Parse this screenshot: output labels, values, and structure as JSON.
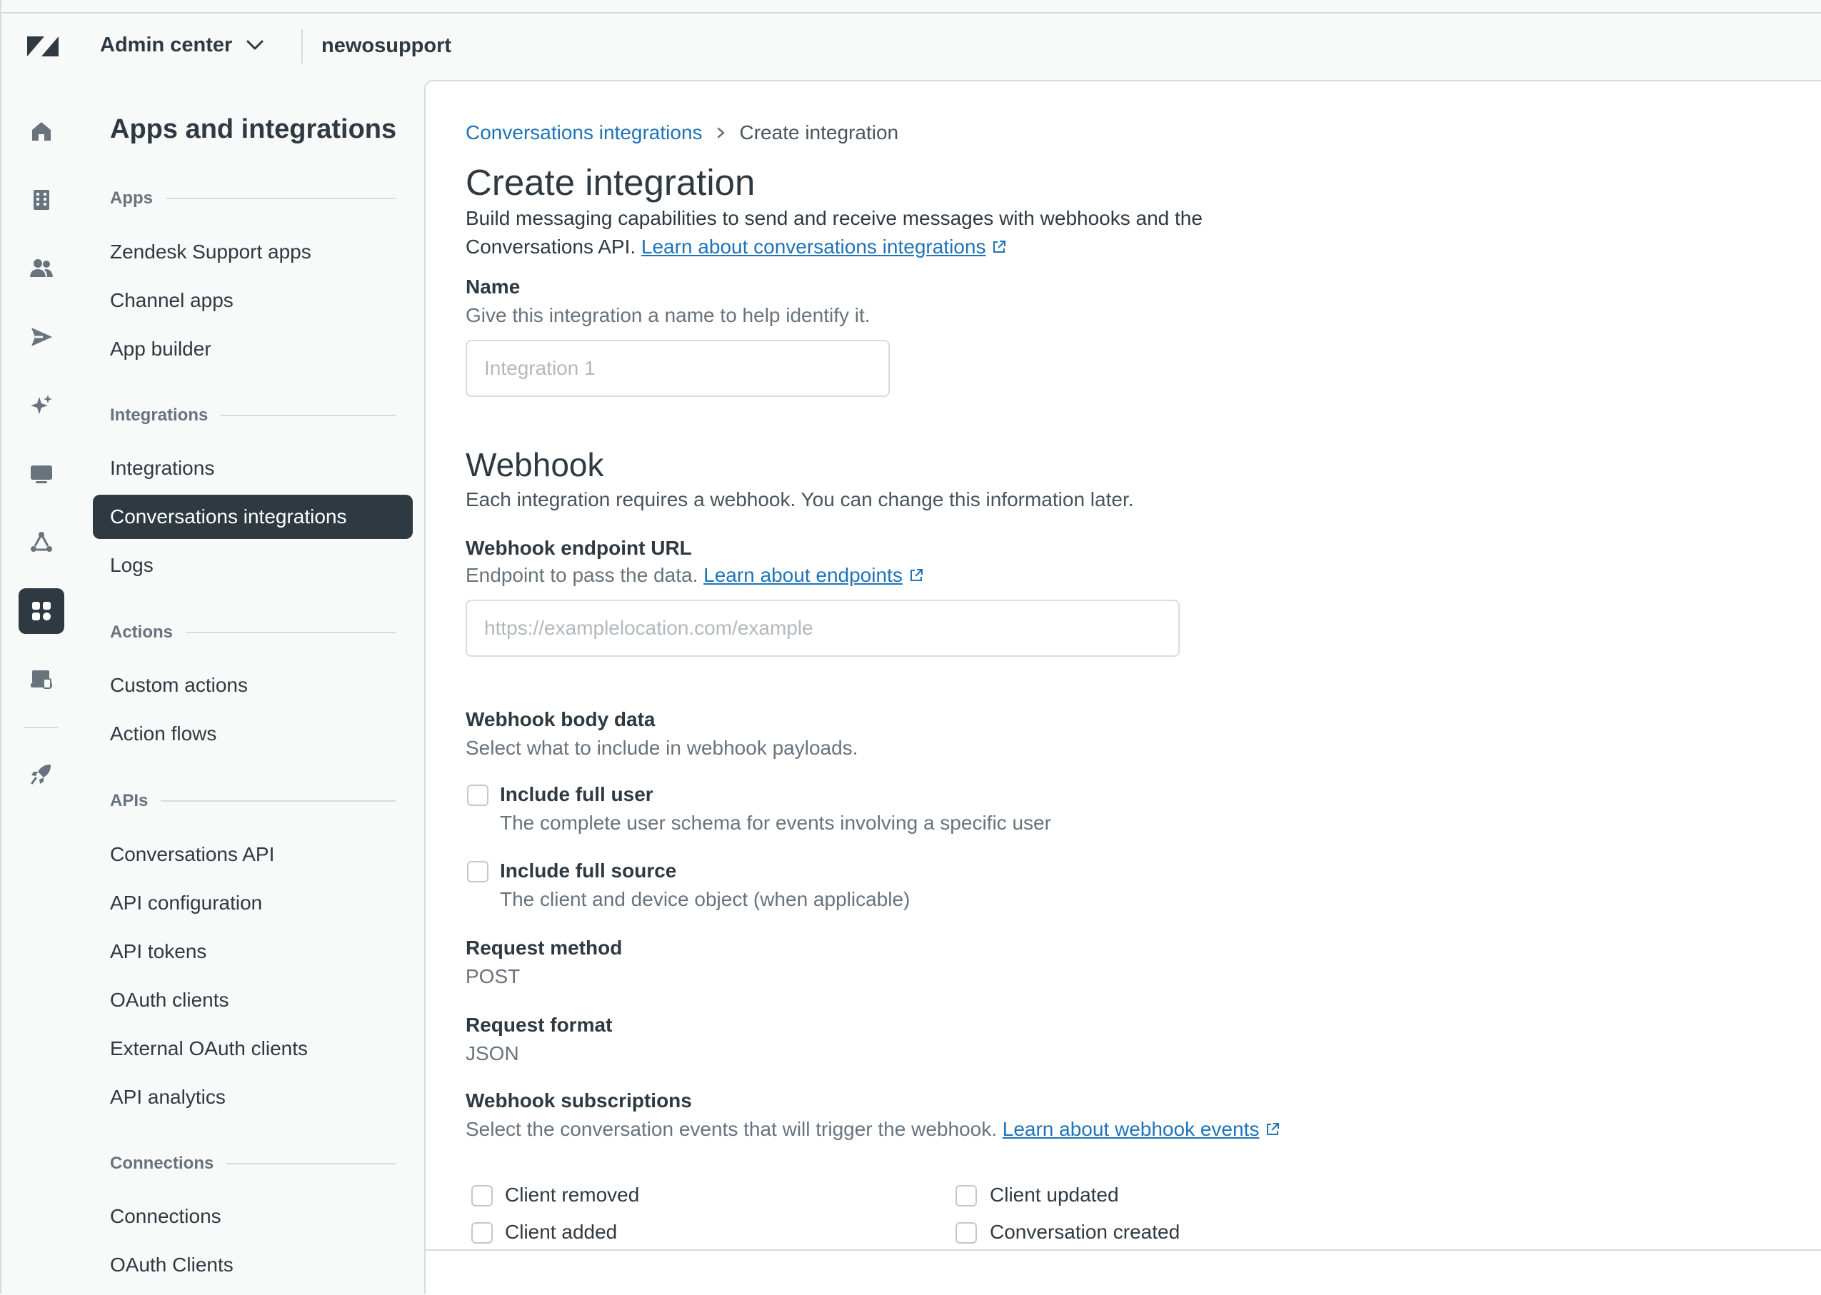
{
  "header": {
    "product": "Admin center",
    "subdomain": "newosupport"
  },
  "rail": {
    "icons": [
      "home-icon",
      "building-icon",
      "people-icon",
      "send-icon",
      "sparkle-icon",
      "monitor-icon",
      "objects-icon",
      "apps-integrations-icon",
      "account-icon",
      "rocket-icon"
    ],
    "active": "apps-integrations-icon"
  },
  "sidebar": {
    "title": "Apps and integrations",
    "sections": {
      "apps": {
        "label": "Apps",
        "items": [
          "Zendesk Support apps",
          "Channel apps",
          "App builder"
        ]
      },
      "integrations": {
        "label": "Integrations",
        "items": [
          "Integrations",
          "Conversations integrations",
          "Logs"
        ]
      },
      "actions": {
        "label": "Actions",
        "items": [
          "Custom actions",
          "Action flows"
        ]
      },
      "apis": {
        "label": "APIs",
        "items": [
          "Conversations API",
          "API configuration",
          "API tokens",
          "OAuth clients",
          "External OAuth clients",
          "API analytics"
        ]
      },
      "connections": {
        "label": "Connections",
        "items": [
          "Connections",
          "OAuth Clients"
        ]
      }
    },
    "active_item": "Conversations integrations"
  },
  "main": {
    "breadcrumb": {
      "parent": "Conversations integrations",
      "separator": ">",
      "current": "Create integration"
    },
    "title": "Create integration",
    "description_line1": "Build messaging capabilities to send and receive messages with webhooks and the",
    "description_line2": "Conversations API.",
    "description_link": "Learn about conversations integrations",
    "name": {
      "label": "Name",
      "hint": "Give this integration a name to help identify it.",
      "placeholder": "Integration 1",
      "value": ""
    },
    "webhook": {
      "title": "Webhook",
      "description": "Each integration requires a webhook. You can change this information later.",
      "endpoint": {
        "label": "Webhook endpoint URL",
        "hint": "Endpoint to pass the data.",
        "hint_link": "Learn about endpoints",
        "placeholder": "https://examplelocation.com/example",
        "value": ""
      },
      "body_data": {
        "label": "Webhook body data",
        "hint": "Select what to include in webhook payloads.",
        "options": [
          {
            "label": "Include full user",
            "description": "The complete user schema for events involving a specific user",
            "checked": false
          },
          {
            "label": "Include full source",
            "description": "The client and device object (when applicable)",
            "checked": false
          }
        ]
      },
      "request_method": {
        "label": "Request method",
        "value": "POST"
      },
      "request_format": {
        "label": "Request format",
        "value": "JSON"
      },
      "subscriptions": {
        "label": "Webhook subscriptions",
        "hint": "Select the conversation events that will trigger the webhook.",
        "hint_link": "Learn about webhook events",
        "events": [
          {
            "label": "Client removed",
            "checked": false
          },
          {
            "label": "Client updated",
            "checked": false
          },
          {
            "label": "Client added",
            "checked": false
          },
          {
            "label": "Conversation created",
            "checked": false
          }
        ]
      }
    }
  },
  "colors": {
    "accent": "#1f73b7",
    "text": "#2f3941",
    "muted": "#68737d",
    "active_nav_bg": "#2f3941",
    "border": "#d8dcde"
  }
}
